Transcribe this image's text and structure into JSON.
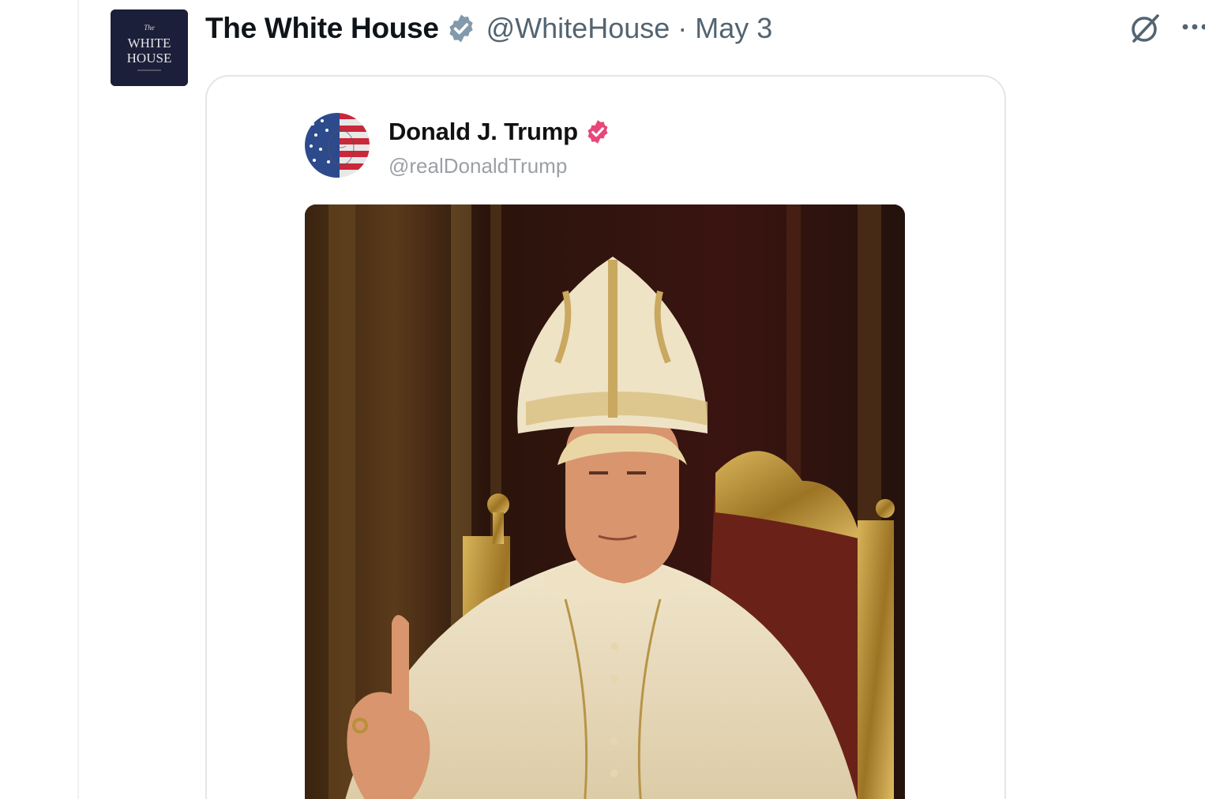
{
  "post": {
    "author": {
      "display_name": "The White House",
      "handle": "@WhiteHouse",
      "avatar_text": [
        "The",
        "WHITE",
        "HOUSE"
      ]
    },
    "separator": "·",
    "timestamp": "May 3"
  },
  "quoted_post": {
    "author": {
      "display_name": "Donald J. Trump",
      "handle": "@realDonaldTrump"
    },
    "media": {
      "kind": "image",
      "subject": "portrait-in-papal-vestments"
    }
  },
  "icons": {
    "verified_primary": "verified-badge-icon",
    "verified_quoted": "verified-badge-icon",
    "grok": "grok-icon",
    "more": "more-icon"
  },
  "colors": {
    "name_text": "#0f1419",
    "secondary_text": "#536471",
    "verified_grey": "#829aab",
    "verified_pink": "#e8477a",
    "card_border": "#e3e6e9",
    "avatar_navy": "#1b1f3a"
  }
}
